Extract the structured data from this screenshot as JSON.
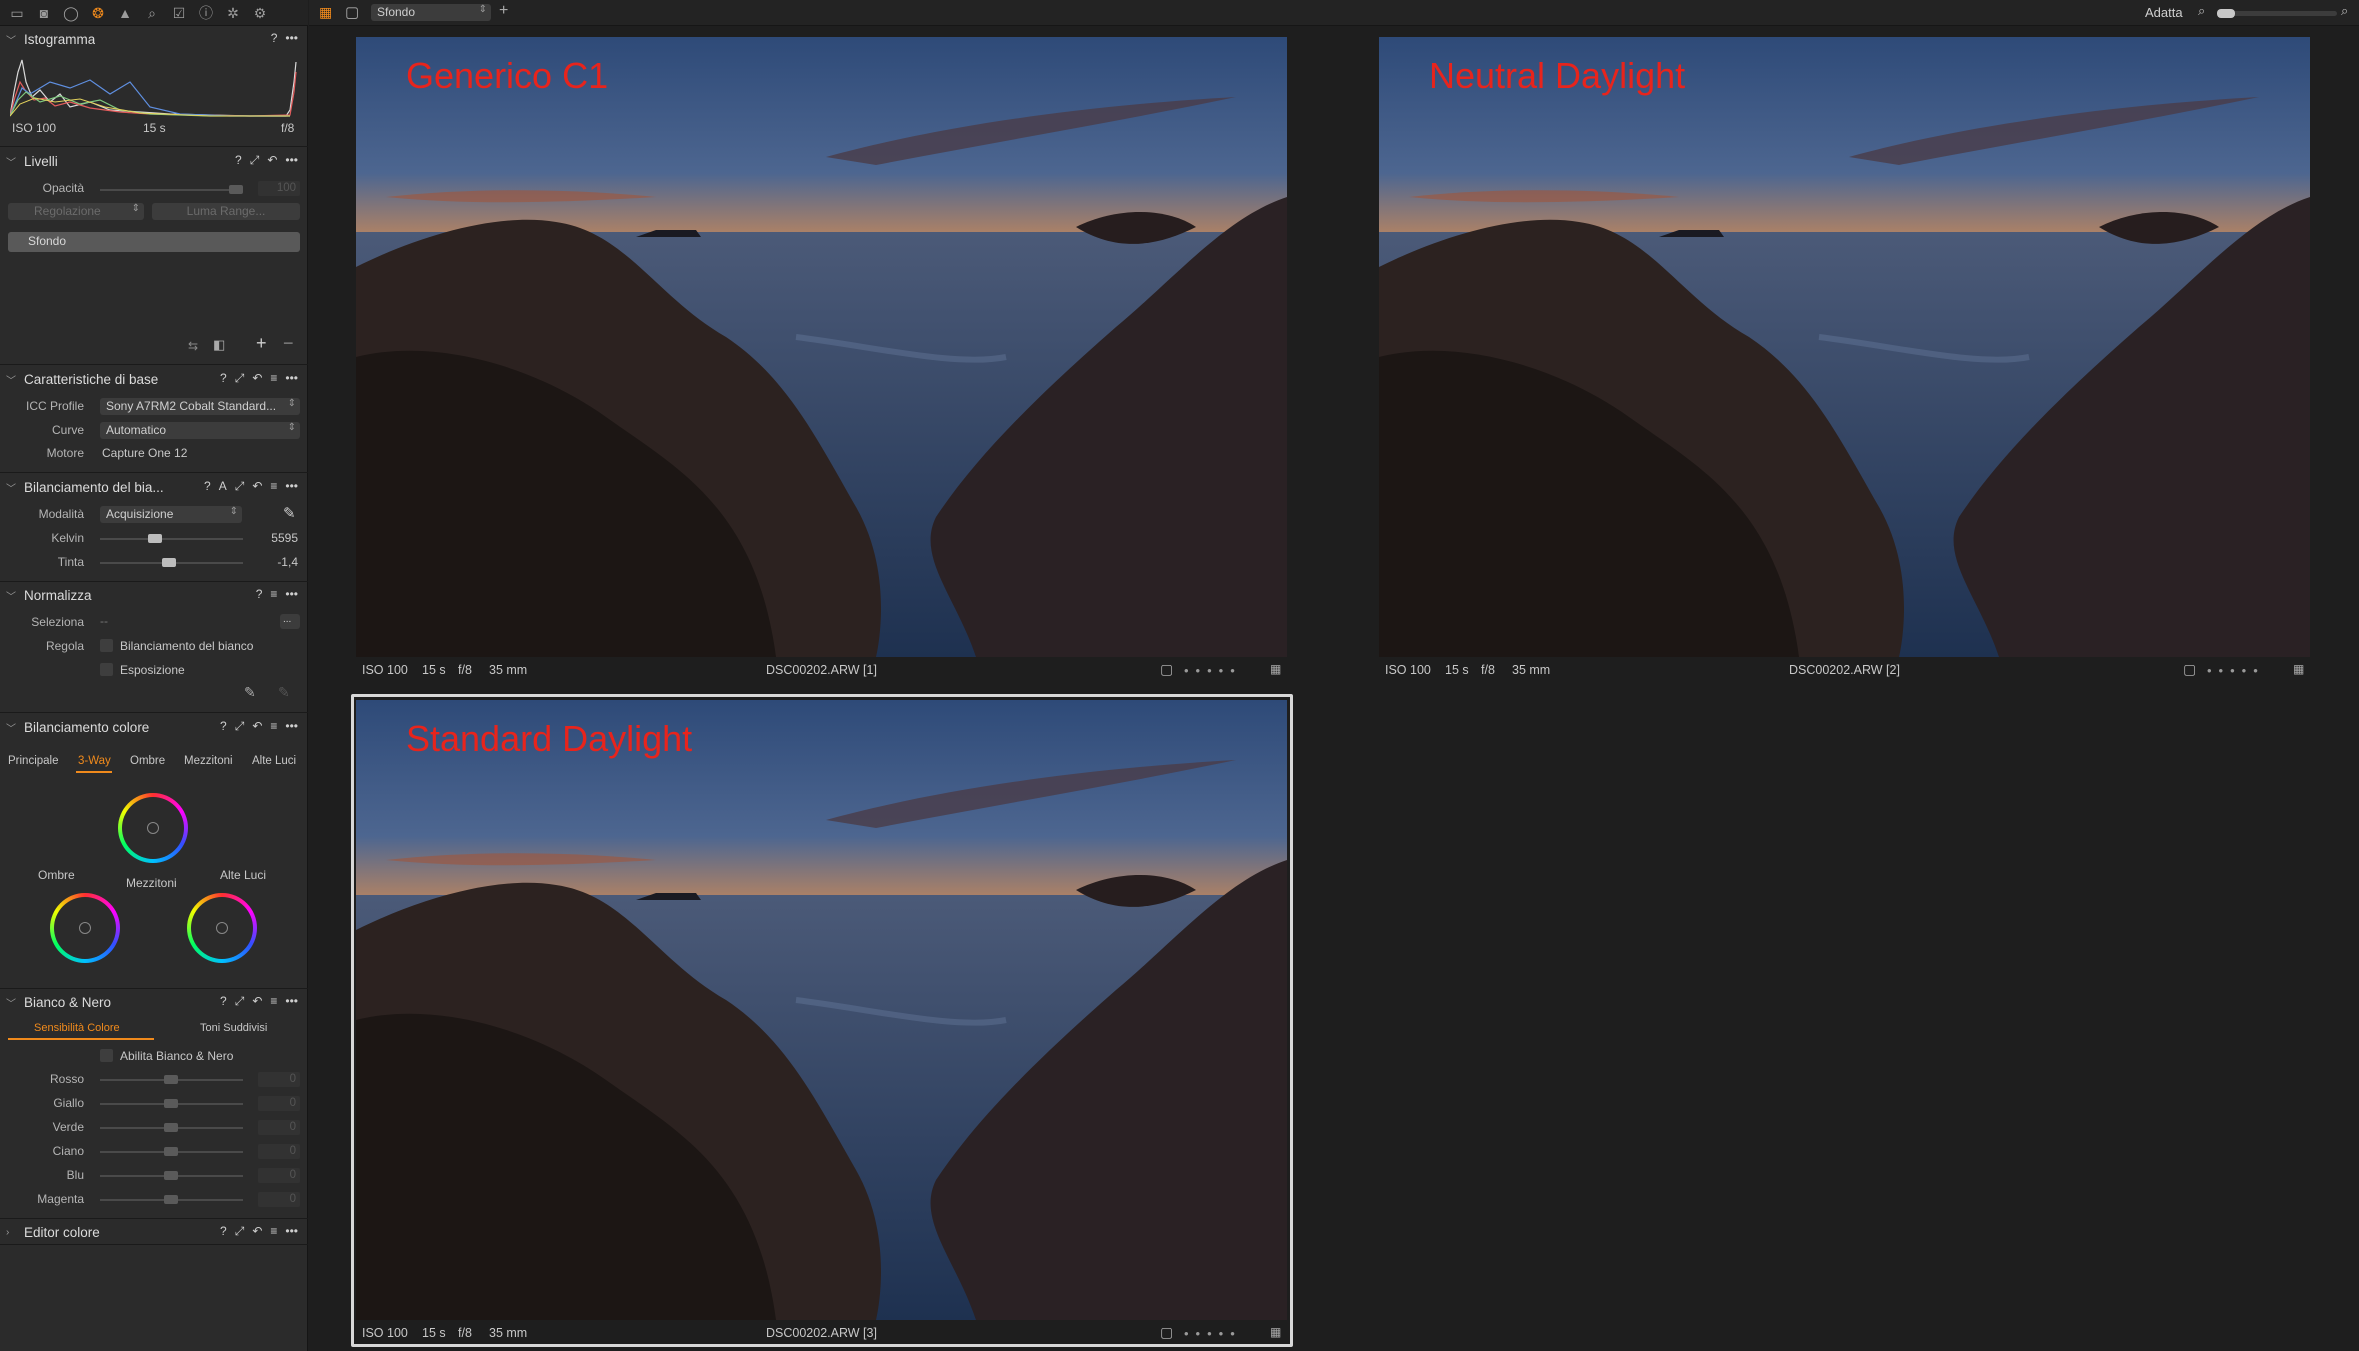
{
  "toolbar": {
    "icons": [
      "folder-icon",
      "camera-icon",
      "circle-icon",
      "color-icon",
      "exposure-icon",
      "search-icon",
      "metadata-icon",
      "info-icon",
      "settings-icon",
      "batch-icon"
    ],
    "view_mode": "Sfondo",
    "zoom_label": "Adatta"
  },
  "histogram": {
    "title": "Istogramma",
    "iso": "ISO 100",
    "shutter": "15 s",
    "aperture": "f/8"
  },
  "levels": {
    "title": "Livelli",
    "opacity_label": "Opacità",
    "opacity_value": "100",
    "adjust_label": "Regolazione",
    "luma_label": "Luma Range...",
    "layer_name": "Sfondo"
  },
  "base": {
    "title": "Caratteristiche di base",
    "icc_label": "ICC Profile",
    "icc_value": "Sony A7RM2 Cobalt Standard...",
    "curve_label": "Curve",
    "curve_value": "Automatico",
    "engine_label": "Motore",
    "engine_value": "Capture One 12"
  },
  "wb": {
    "title": "Bilanciamento del bia...",
    "mode_label": "Modalità",
    "mode_value": "Acquisizione",
    "kelvin_label": "Kelvin",
    "kelvin_value": "5595",
    "kelvin_level": 0.37,
    "tint_label": "Tinta",
    "tint_value": "-1,4",
    "tint_level": 0.48
  },
  "norm": {
    "title": "Normalizza",
    "select_label": "Seleziona",
    "select_value": "--",
    "select_btn": "...",
    "adjust_label": "Regola",
    "opt1": "Bilanciamento del bianco",
    "opt2": "Esposizione"
  },
  "cb": {
    "title": "Bilanciamento colore",
    "tabs": [
      "Principale",
      "3-Way",
      "Ombre",
      "Mezzitoni",
      "Alte Luci"
    ],
    "active_tab": 1,
    "mid_label": "Mezzitoni",
    "shadow_label": "Ombre",
    "high_label": "Alte Luci"
  },
  "bw": {
    "title": "Bianco & Nero",
    "tab1": "Sensibilità Colore",
    "tab2": "Toni Suddivisi",
    "enable": "Abilita Bianco & Nero",
    "sliders": [
      {
        "label": "Rosso",
        "value": "0"
      },
      {
        "label": "Giallo",
        "value": "0"
      },
      {
        "label": "Verde",
        "value": "0"
      },
      {
        "label": "Ciano",
        "value": "0"
      },
      {
        "label": "Blu",
        "value": "0"
      },
      {
        "label": "Magenta",
        "value": "0"
      }
    ]
  },
  "editor": {
    "title": "Editor colore"
  },
  "images": [
    {
      "title": "Generico C1",
      "iso": "ISO 100",
      "shutter": "15 s",
      "aperture": "f/8",
      "focal": "35 mm",
      "file": "DSC00202.ARW [1]"
    },
    {
      "title": "Neutral Daylight",
      "iso": "ISO 100",
      "shutter": "15 s",
      "aperture": "f/8",
      "focal": "35 mm",
      "file": "DSC00202.ARW [2]"
    },
    {
      "title": "Standard Daylight",
      "iso": "ISO 100",
      "shutter": "15 s",
      "aperture": "f/8",
      "focal": "35 mm",
      "file": "DSC00202.ARW [3]"
    }
  ],
  "colors": {
    "accent": "#f08a1c",
    "title_red": "#e8241c",
    "panel": "#2b2b2b",
    "viewer": "#1e1e1e"
  }
}
